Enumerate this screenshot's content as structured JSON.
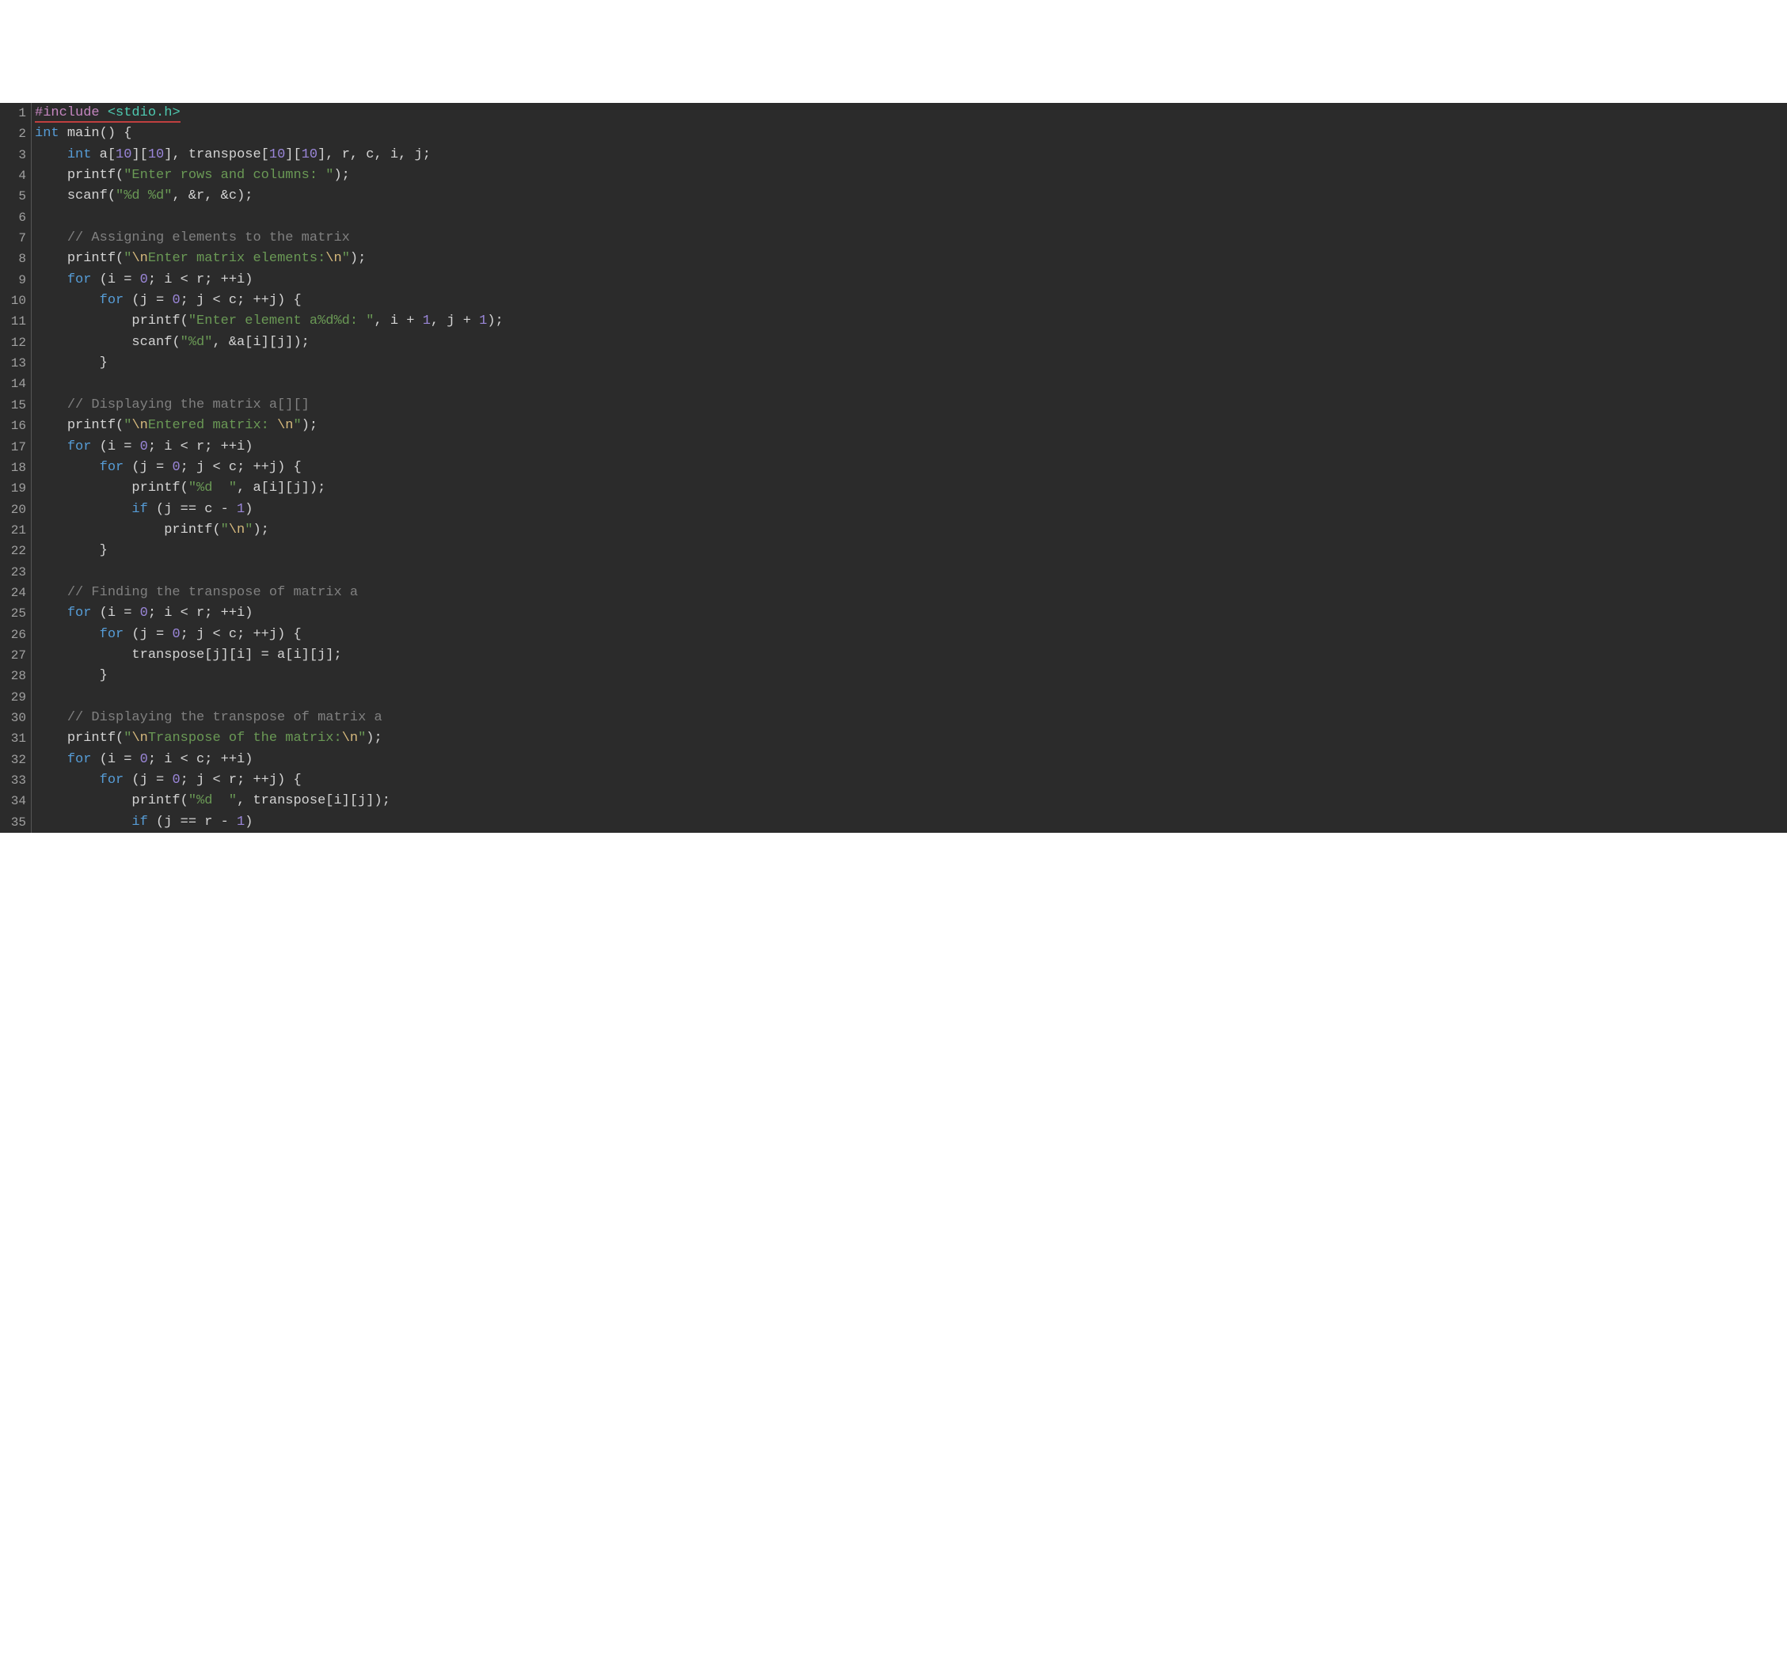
{
  "editor": {
    "theme": "dark",
    "background": "#2b2b2b",
    "gutter_bg": "#2b2b2b",
    "gutter_fg": "#a0a0a0",
    "foreground": "#d4d4d4",
    "error_underline_color": "#c04040",
    "font": "Consolas, monospace",
    "visible_line_start": 1,
    "visible_line_end": 35,
    "colors": {
      "keyword": "#569cd6",
      "number": "#9a86d8",
      "string": "#6a9955",
      "escape": "#d7ba7d",
      "comment": "#808080",
      "preprocessor": "#c586c0",
      "include_path": "#4ec9b0"
    },
    "line_numbers": [
      "1",
      "2",
      "3",
      "4",
      "5",
      "6",
      "7",
      "8",
      "9",
      "10",
      "11",
      "12",
      "13",
      "14",
      "15",
      "16",
      "17",
      "18",
      "19",
      "20",
      "21",
      "22",
      "23",
      "24",
      "25",
      "26",
      "27",
      "28",
      "29",
      "30",
      "31",
      "32",
      "33",
      "34",
      "35"
    ],
    "lines": [
      {
        "n": 1,
        "error_underline": true,
        "tokens": [
          {
            "cls": "tok-pp",
            "t": "#include "
          },
          {
            "cls": "tok-inc",
            "t": "<stdio.h>"
          }
        ]
      },
      {
        "n": 2,
        "tokens": [
          {
            "cls": "tok-typ",
            "t": "int"
          },
          {
            "cls": "tok-pn",
            "t": " "
          },
          {
            "cls": "tok-fn",
            "t": "main"
          },
          {
            "cls": "tok-pn",
            "t": "() {"
          }
        ]
      },
      {
        "n": 3,
        "tokens": [
          {
            "cls": "tok-pn",
            "t": "    "
          },
          {
            "cls": "tok-typ",
            "t": "int"
          },
          {
            "cls": "tok-pn",
            "t": " a["
          },
          {
            "cls": "tok-num",
            "t": "10"
          },
          {
            "cls": "tok-pn",
            "t": "]["
          },
          {
            "cls": "tok-num",
            "t": "10"
          },
          {
            "cls": "tok-pn",
            "t": "], transpose["
          },
          {
            "cls": "tok-num",
            "t": "10"
          },
          {
            "cls": "tok-pn",
            "t": "]["
          },
          {
            "cls": "tok-num",
            "t": "10"
          },
          {
            "cls": "tok-pn",
            "t": "], r, c, i, j;"
          }
        ]
      },
      {
        "n": 4,
        "tokens": [
          {
            "cls": "tok-pn",
            "t": "    "
          },
          {
            "cls": "tok-fn",
            "t": "printf"
          },
          {
            "cls": "tok-pn",
            "t": "("
          },
          {
            "cls": "tok-str",
            "t": "\"Enter rows and columns: \""
          },
          {
            "cls": "tok-pn",
            "t": ");"
          }
        ]
      },
      {
        "n": 5,
        "tokens": [
          {
            "cls": "tok-pn",
            "t": "    "
          },
          {
            "cls": "tok-fn",
            "t": "scanf"
          },
          {
            "cls": "tok-pn",
            "t": "("
          },
          {
            "cls": "tok-str",
            "t": "\"%d %d\""
          },
          {
            "cls": "tok-pn",
            "t": ", &r, &c);"
          }
        ]
      },
      {
        "n": 6,
        "tokens": []
      },
      {
        "n": 7,
        "tokens": [
          {
            "cls": "tok-pn",
            "t": "    "
          },
          {
            "cls": "tok-cmt",
            "t": "// Assigning elements to the matrix"
          }
        ]
      },
      {
        "n": 8,
        "tokens": [
          {
            "cls": "tok-pn",
            "t": "    "
          },
          {
            "cls": "tok-fn",
            "t": "printf"
          },
          {
            "cls": "tok-pn",
            "t": "("
          },
          {
            "cls": "tok-str",
            "t": "\""
          },
          {
            "cls": "tok-esc",
            "t": "\\n"
          },
          {
            "cls": "tok-str",
            "t": "Enter matrix elements:"
          },
          {
            "cls": "tok-esc",
            "t": "\\n"
          },
          {
            "cls": "tok-str",
            "t": "\""
          },
          {
            "cls": "tok-pn",
            "t": ");"
          }
        ]
      },
      {
        "n": 9,
        "tokens": [
          {
            "cls": "tok-pn",
            "t": "    "
          },
          {
            "cls": "tok-kw",
            "t": "for"
          },
          {
            "cls": "tok-pn",
            "t": " (i = "
          },
          {
            "cls": "tok-num",
            "t": "0"
          },
          {
            "cls": "tok-pn",
            "t": "; i < r; ++i)"
          }
        ]
      },
      {
        "n": 10,
        "tokens": [
          {
            "cls": "tok-pn",
            "t": "        "
          },
          {
            "cls": "tok-kw",
            "t": "for"
          },
          {
            "cls": "tok-pn",
            "t": " (j = "
          },
          {
            "cls": "tok-num",
            "t": "0"
          },
          {
            "cls": "tok-pn",
            "t": "; j < c; ++j) {"
          }
        ]
      },
      {
        "n": 11,
        "tokens": [
          {
            "cls": "tok-pn",
            "t": "            "
          },
          {
            "cls": "tok-fn",
            "t": "printf"
          },
          {
            "cls": "tok-pn",
            "t": "("
          },
          {
            "cls": "tok-str",
            "t": "\"Enter element a%d%d: \""
          },
          {
            "cls": "tok-pn",
            "t": ", i + "
          },
          {
            "cls": "tok-num",
            "t": "1"
          },
          {
            "cls": "tok-pn",
            "t": ", j + "
          },
          {
            "cls": "tok-num",
            "t": "1"
          },
          {
            "cls": "tok-pn",
            "t": ");"
          }
        ]
      },
      {
        "n": 12,
        "tokens": [
          {
            "cls": "tok-pn",
            "t": "            "
          },
          {
            "cls": "tok-fn",
            "t": "scanf"
          },
          {
            "cls": "tok-pn",
            "t": "("
          },
          {
            "cls": "tok-str",
            "t": "\"%d\""
          },
          {
            "cls": "tok-pn",
            "t": ", &a[i][j]);"
          }
        ]
      },
      {
        "n": 13,
        "tokens": [
          {
            "cls": "tok-pn",
            "t": "        }"
          }
        ]
      },
      {
        "n": 14,
        "tokens": []
      },
      {
        "n": 15,
        "tokens": [
          {
            "cls": "tok-pn",
            "t": "    "
          },
          {
            "cls": "tok-cmt",
            "t": "// Displaying the matrix a[][]"
          }
        ]
      },
      {
        "n": 16,
        "tokens": [
          {
            "cls": "tok-pn",
            "t": "    "
          },
          {
            "cls": "tok-fn",
            "t": "printf"
          },
          {
            "cls": "tok-pn",
            "t": "("
          },
          {
            "cls": "tok-str",
            "t": "\""
          },
          {
            "cls": "tok-esc",
            "t": "\\n"
          },
          {
            "cls": "tok-str",
            "t": "Entered matrix: "
          },
          {
            "cls": "tok-esc",
            "t": "\\n"
          },
          {
            "cls": "tok-str",
            "t": "\""
          },
          {
            "cls": "tok-pn",
            "t": ");"
          }
        ]
      },
      {
        "n": 17,
        "tokens": [
          {
            "cls": "tok-pn",
            "t": "    "
          },
          {
            "cls": "tok-kw",
            "t": "for"
          },
          {
            "cls": "tok-pn",
            "t": " (i = "
          },
          {
            "cls": "tok-num",
            "t": "0"
          },
          {
            "cls": "tok-pn",
            "t": "; i < r; ++i)"
          }
        ]
      },
      {
        "n": 18,
        "tokens": [
          {
            "cls": "tok-pn",
            "t": "        "
          },
          {
            "cls": "tok-kw",
            "t": "for"
          },
          {
            "cls": "tok-pn",
            "t": " (j = "
          },
          {
            "cls": "tok-num",
            "t": "0"
          },
          {
            "cls": "tok-pn",
            "t": "; j < c; ++j) {"
          }
        ]
      },
      {
        "n": 19,
        "tokens": [
          {
            "cls": "tok-pn",
            "t": "            "
          },
          {
            "cls": "tok-fn",
            "t": "printf"
          },
          {
            "cls": "tok-pn",
            "t": "("
          },
          {
            "cls": "tok-str",
            "t": "\"%d  \""
          },
          {
            "cls": "tok-pn",
            "t": ", a[i][j]);"
          }
        ]
      },
      {
        "n": 20,
        "tokens": [
          {
            "cls": "tok-pn",
            "t": "            "
          },
          {
            "cls": "tok-kw",
            "t": "if"
          },
          {
            "cls": "tok-pn",
            "t": " (j == c - "
          },
          {
            "cls": "tok-num",
            "t": "1"
          },
          {
            "cls": "tok-pn",
            "t": ")"
          }
        ]
      },
      {
        "n": 21,
        "tokens": [
          {
            "cls": "tok-pn",
            "t": "                "
          },
          {
            "cls": "tok-fn",
            "t": "printf"
          },
          {
            "cls": "tok-pn",
            "t": "("
          },
          {
            "cls": "tok-str",
            "t": "\""
          },
          {
            "cls": "tok-esc",
            "t": "\\n"
          },
          {
            "cls": "tok-str",
            "t": "\""
          },
          {
            "cls": "tok-pn",
            "t": ");"
          }
        ]
      },
      {
        "n": 22,
        "tokens": [
          {
            "cls": "tok-pn",
            "t": "        }"
          }
        ]
      },
      {
        "n": 23,
        "tokens": []
      },
      {
        "n": 24,
        "tokens": [
          {
            "cls": "tok-pn",
            "t": "    "
          },
          {
            "cls": "tok-cmt",
            "t": "// Finding the transpose of matrix a"
          }
        ]
      },
      {
        "n": 25,
        "tokens": [
          {
            "cls": "tok-pn",
            "t": "    "
          },
          {
            "cls": "tok-kw",
            "t": "for"
          },
          {
            "cls": "tok-pn",
            "t": " (i = "
          },
          {
            "cls": "tok-num",
            "t": "0"
          },
          {
            "cls": "tok-pn",
            "t": "; i < r; ++i)"
          }
        ]
      },
      {
        "n": 26,
        "tokens": [
          {
            "cls": "tok-pn",
            "t": "        "
          },
          {
            "cls": "tok-kw",
            "t": "for"
          },
          {
            "cls": "tok-pn",
            "t": " (j = "
          },
          {
            "cls": "tok-num",
            "t": "0"
          },
          {
            "cls": "tok-pn",
            "t": "; j < c; ++j) {"
          }
        ]
      },
      {
        "n": 27,
        "tokens": [
          {
            "cls": "tok-pn",
            "t": "            transpose[j][i] = a[i][j];"
          }
        ]
      },
      {
        "n": 28,
        "tokens": [
          {
            "cls": "tok-pn",
            "t": "        }"
          }
        ]
      },
      {
        "n": 29,
        "tokens": []
      },
      {
        "n": 30,
        "tokens": [
          {
            "cls": "tok-pn",
            "t": "    "
          },
          {
            "cls": "tok-cmt",
            "t": "// Displaying the transpose of matrix a"
          }
        ]
      },
      {
        "n": 31,
        "tokens": [
          {
            "cls": "tok-pn",
            "t": "    "
          },
          {
            "cls": "tok-fn",
            "t": "printf"
          },
          {
            "cls": "tok-pn",
            "t": "("
          },
          {
            "cls": "tok-str",
            "t": "\""
          },
          {
            "cls": "tok-esc",
            "t": "\\n"
          },
          {
            "cls": "tok-str",
            "t": "Transpose of the matrix:"
          },
          {
            "cls": "tok-esc",
            "t": "\\n"
          },
          {
            "cls": "tok-str",
            "t": "\""
          },
          {
            "cls": "tok-pn",
            "t": ");"
          }
        ]
      },
      {
        "n": 32,
        "tokens": [
          {
            "cls": "tok-pn",
            "t": "    "
          },
          {
            "cls": "tok-kw",
            "t": "for"
          },
          {
            "cls": "tok-pn",
            "t": " (i = "
          },
          {
            "cls": "tok-num",
            "t": "0"
          },
          {
            "cls": "tok-pn",
            "t": "; i < c; ++i)"
          }
        ]
      },
      {
        "n": 33,
        "tokens": [
          {
            "cls": "tok-pn",
            "t": "        "
          },
          {
            "cls": "tok-kw",
            "t": "for"
          },
          {
            "cls": "tok-pn",
            "t": " (j = "
          },
          {
            "cls": "tok-num",
            "t": "0"
          },
          {
            "cls": "tok-pn",
            "t": "; j < r; ++j) {"
          }
        ]
      },
      {
        "n": 34,
        "tokens": [
          {
            "cls": "tok-pn",
            "t": "            "
          },
          {
            "cls": "tok-fn",
            "t": "printf"
          },
          {
            "cls": "tok-pn",
            "t": "("
          },
          {
            "cls": "tok-str",
            "t": "\"%d  \""
          },
          {
            "cls": "tok-pn",
            "t": ", transpose[i][j]);"
          }
        ]
      },
      {
        "n": 35,
        "tokens": [
          {
            "cls": "tok-pn",
            "t": "            "
          },
          {
            "cls": "tok-kw",
            "t": "if"
          },
          {
            "cls": "tok-pn",
            "t": " (j == r - "
          },
          {
            "cls": "tok-num",
            "t": "1"
          },
          {
            "cls": "tok-pn",
            "t": ")"
          }
        ]
      }
    ]
  }
}
